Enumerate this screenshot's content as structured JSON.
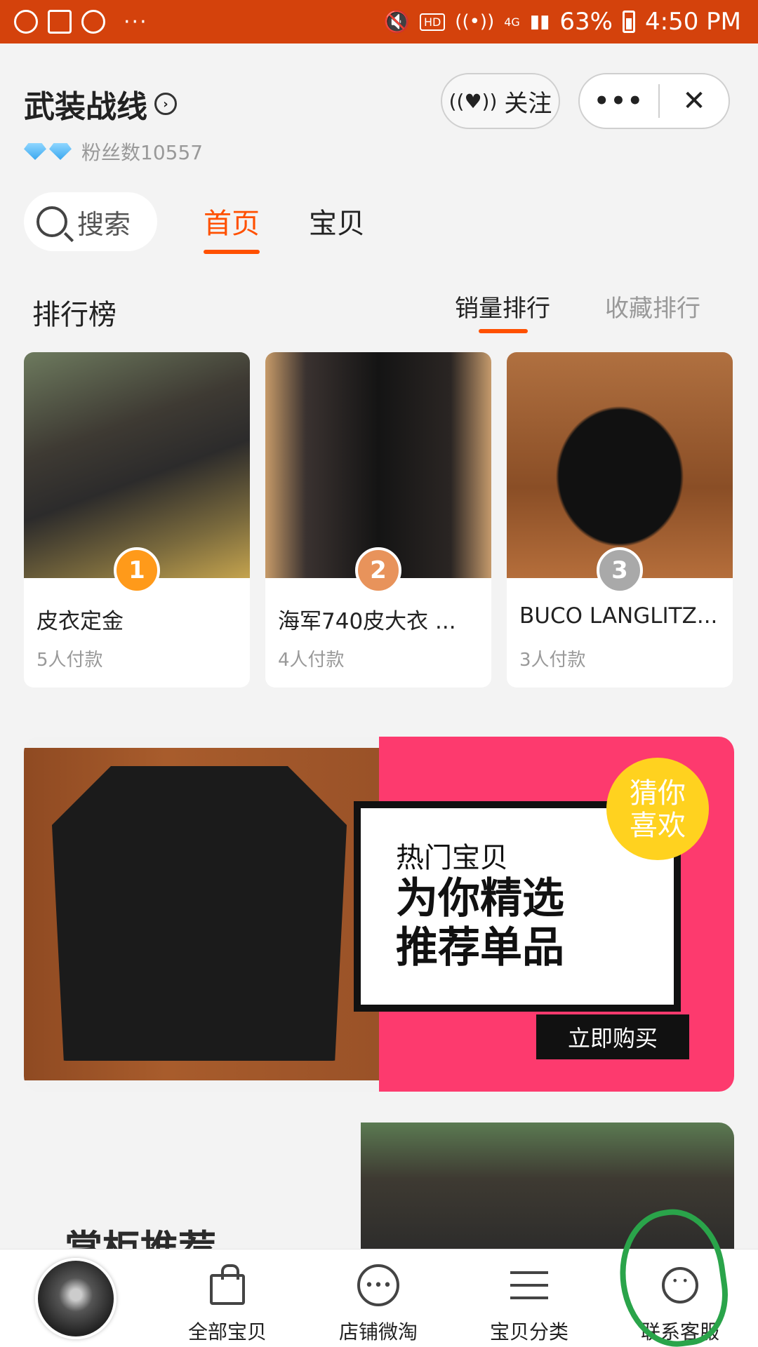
{
  "status_bar": {
    "battery": "63%",
    "time": "4:50 PM",
    "hd": "HD",
    "net": "4G",
    "dots": "···"
  },
  "header": {
    "shop_name": "武装战线",
    "fans_label": "粉丝数10557",
    "follow_label": "关注",
    "more_label": "•••",
    "close_label": "✕"
  },
  "nav_tabs": {
    "search_label": "搜索",
    "tabs": [
      {
        "label": "首页",
        "active": true
      },
      {
        "label": "宝贝",
        "active": false
      }
    ]
  },
  "ranking": {
    "title": "排行榜",
    "tabs": [
      {
        "label": "销量排行",
        "active": true
      },
      {
        "label": "收藏排行",
        "active": false
      }
    ],
    "items": [
      {
        "rank": "1",
        "name": "皮衣定金",
        "sold": "5人付款"
      },
      {
        "rank": "2",
        "name": "海军740皮大衣 ...",
        "sold": "4人付款"
      },
      {
        "rank": "3",
        "name": "BUCO LANGLITZ...",
        "sold": "3人付款"
      }
    ]
  },
  "banner": {
    "subtitle": "热门宝贝",
    "line1": "为你精选",
    "line2": "推荐单品",
    "buy_label": "立即购买",
    "guess_line1": "猜你",
    "guess_line2": "喜欢"
  },
  "keeper": {
    "title": "掌柜推荐"
  },
  "bottom_nav": {
    "items": [
      {
        "label": "全部宝贝",
        "icon": "bag-icon"
      },
      {
        "label": "店铺微淘",
        "icon": "broadcast-icon"
      },
      {
        "label": "宝贝分类",
        "icon": "list-icon"
      },
      {
        "label": "联系客服",
        "icon": "customer-service-icon"
      }
    ]
  },
  "colors": {
    "status_bar": "#d4420c",
    "accent": "#ff5000",
    "banner_pink": "#fd3a6e",
    "badge_yellow": "#ffd21f",
    "annotation_green": "#2aa44a"
  }
}
